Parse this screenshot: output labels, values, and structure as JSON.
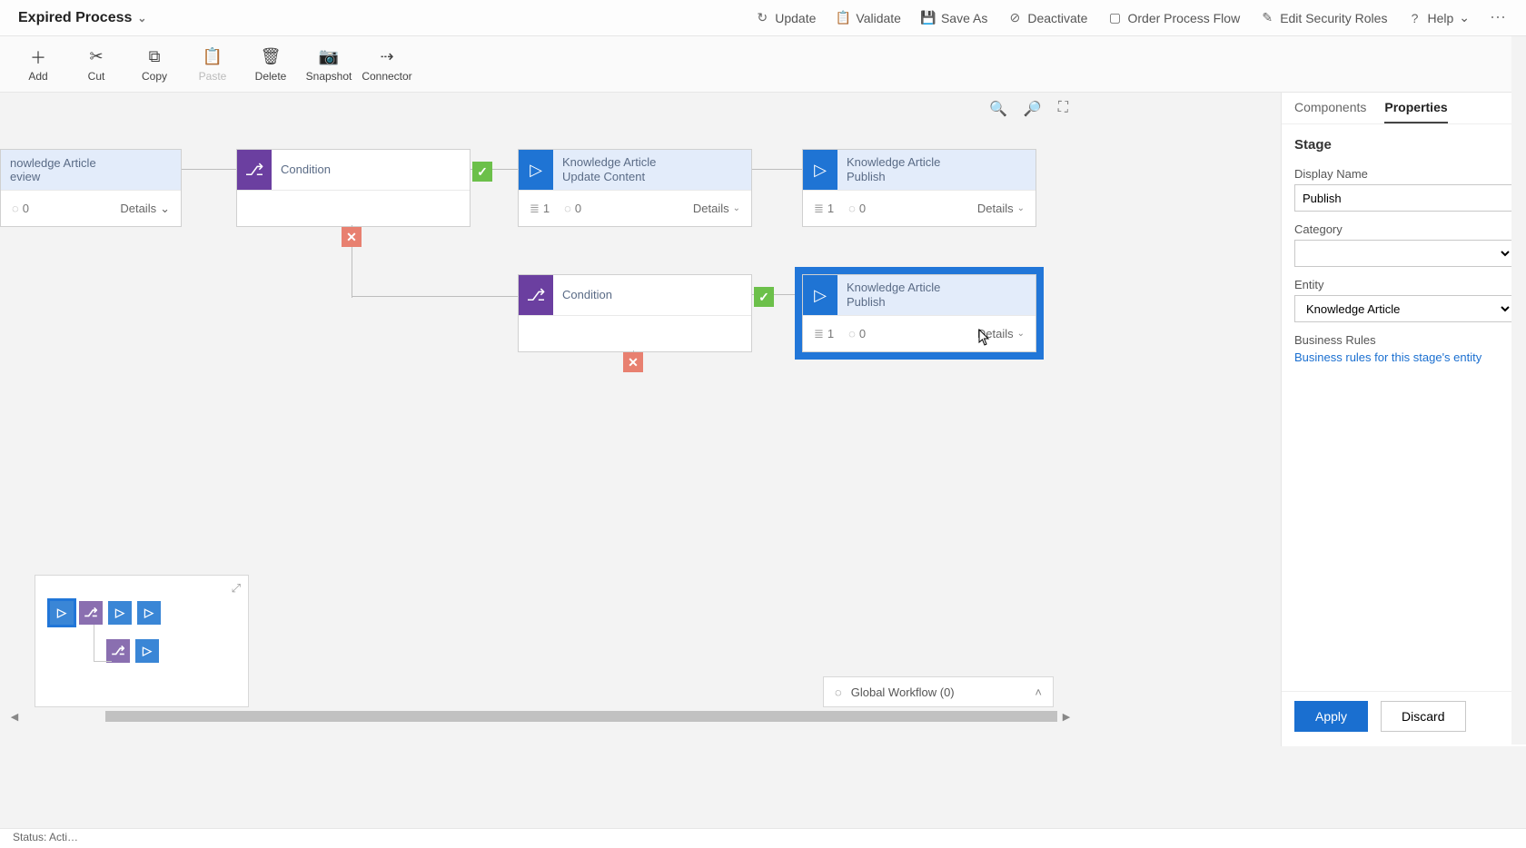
{
  "title": "Expired Process",
  "topCommands": {
    "update": {
      "label": "Update",
      "icon": "↻"
    },
    "validate": {
      "label": "Validate",
      "icon": "📋"
    },
    "saveAs": {
      "label": "Save As",
      "icon": "💾"
    },
    "deactivate": {
      "label": "Deactivate",
      "icon": "⊘"
    },
    "order": {
      "label": "Order Process Flow",
      "icon": "▢"
    },
    "security": {
      "label": "Edit Security Roles",
      "icon": "✎"
    },
    "help": {
      "label": "Help",
      "icon": "?"
    }
  },
  "ribbon": {
    "add": {
      "label": "Add",
      "icon": "＋"
    },
    "cut": {
      "label": "Cut",
      "icon": "✂"
    },
    "copy": {
      "label": "Copy",
      "icon": "⧉"
    },
    "paste": {
      "label": "Paste",
      "icon": "📋",
      "disabled": true
    },
    "delete": {
      "label": "Delete",
      "icon": "🗑"
    },
    "snapshot": {
      "label": "Snapshot",
      "icon": "📷"
    },
    "connector": {
      "label": "Connector",
      "icon": "⇢"
    }
  },
  "nodes": {
    "review": {
      "line1": "nowledge Article",
      "line2": "eview",
      "count": "0",
      "details": "Details"
    },
    "cond1": {
      "title": "Condition"
    },
    "update": {
      "line1": "Knowledge Article",
      "line2": "Update Content",
      "steps": "1",
      "count": "0",
      "details": "Details"
    },
    "publish1": {
      "line1": "Knowledge Article",
      "line2": "Publish",
      "steps": "1",
      "count": "0",
      "details": "Details"
    },
    "cond2": {
      "title": "Condition"
    },
    "publish2": {
      "line1": "Knowledge Article",
      "line2": "Publish",
      "steps": "1",
      "count": "0",
      "details": "Details"
    }
  },
  "globalWorkflow": "Global Workflow (0)",
  "panel": {
    "tabs": {
      "components": "Components",
      "properties": "Properties"
    },
    "heading": "Stage",
    "displayName": {
      "label": "Display Name",
      "value": "Publish"
    },
    "category": {
      "label": "Category",
      "value": ""
    },
    "entity": {
      "label": "Entity",
      "value": "Knowledge Article"
    },
    "businessRules": {
      "label": "Business Rules",
      "link": "Business rules for this stage's entity"
    },
    "apply": "Apply",
    "discard": "Discard"
  },
  "status": "Status: Acti…"
}
